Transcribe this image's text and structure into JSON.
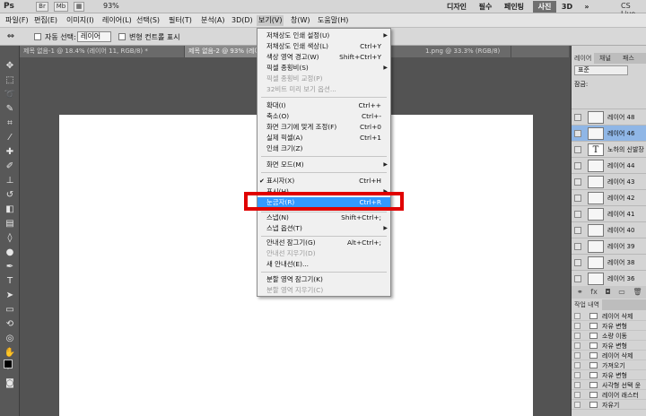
{
  "app": {
    "logo": "Ps",
    "zoom": "93%",
    "workspaces": [
      "디자인",
      "필수",
      "페인팅",
      "사진",
      "3D"
    ],
    "active_workspace": "사진",
    "cs_live": "CS Live"
  },
  "menubar": [
    "파일(F)",
    "편집(E)",
    "이미지(I)",
    "레이어(L)",
    "선택(S)",
    "필터(T)",
    "분석(A)",
    "3D(D)",
    "보기(V)",
    "창(W)",
    "도움말(H)"
  ],
  "options": {
    "auto_select_label": "자동 선택:",
    "auto_select_value": "레이어",
    "transform_controls_label": "변형 컨트롤 표시"
  },
  "tabs": [
    "제목 없음-1 @ 18.4% (레이어 11, RGB/8) *",
    "제목 없음-2 @ 93% (레이어 46, RGB/8) *",
    "1.png @ 33.3% (RGB/8)"
  ],
  "view_menu": [
    {
      "label": "저채상도 인쇄 설정(U)",
      "shortcut": "",
      "submenu": true
    },
    {
      "label": "저채상도 인쇄 색상(L)",
      "shortcut": "Ctrl+Y"
    },
    {
      "label": "색상 영역 경고(W)",
      "shortcut": "Shift+Ctrl+Y"
    },
    {
      "label": "픽셀 종횡비(S)",
      "shortcut": "",
      "submenu": true
    },
    {
      "label": "픽셀 종횡비 교정(P)",
      "shortcut": "",
      "disabled": true
    },
    {
      "label": "32비트 미리 보기 옵션...",
      "shortcut": "",
      "disabled": true
    },
    {
      "label": "확대(I)",
      "shortcut": "Ctrl++"
    },
    {
      "label": "축소(O)",
      "shortcut": "Ctrl+-"
    },
    {
      "label": "화면 크기에 맞게 조정(F)",
      "shortcut": "Ctrl+0"
    },
    {
      "label": "실제 픽셀(A)",
      "shortcut": "Ctrl+1"
    },
    {
      "label": "인쇄 크기(Z)",
      "shortcut": ""
    },
    {
      "label": "화면 모드(M)",
      "shortcut": "",
      "submenu": true
    },
    {
      "label": "표시자(X)",
      "shortcut": "Ctrl+H",
      "checked": true
    },
    {
      "label": "표시(H)",
      "shortcut": "",
      "submenu": true
    },
    {
      "label": "눈금자(R)",
      "shortcut": "Ctrl+R",
      "highlighted": true
    },
    {
      "label": "스냅(N)",
      "shortcut": "Shift+Ctrl+;"
    },
    {
      "label": "스냅 옵션(T)",
      "shortcut": "",
      "submenu": true
    },
    {
      "label": "안내선 잠그기(G)",
      "shortcut": "Alt+Ctrl+;"
    },
    {
      "label": "안내선 지우기(D)",
      "shortcut": "",
      "disabled": true
    },
    {
      "label": "새 안내선(E)...",
      "shortcut": ""
    },
    {
      "label": "분할 영역 잠그기(K)",
      "shortcut": ""
    },
    {
      "label": "분할 영역 지우기(C)",
      "shortcut": "",
      "disabled": true
    }
  ],
  "panel": {
    "tabs": [
      "레이어",
      "채널",
      "패스"
    ],
    "blend_mode": "표준",
    "lock_label": "잠금:",
    "layers": [
      {
        "name": "레이어 48"
      },
      {
        "name": "레이어 46",
        "selected": true
      },
      {
        "name": "노하의 신발장",
        "type": "T"
      },
      {
        "name": "레이어 44"
      },
      {
        "name": "레이어 43"
      },
      {
        "name": "레이어 42"
      },
      {
        "name": "레이어 41"
      },
      {
        "name": "레이어 40"
      },
      {
        "name": "레이어 39"
      },
      {
        "name": "레이어 38"
      },
      {
        "name": "레이어 36"
      }
    ],
    "history_title": "작업 내역",
    "history": [
      "레이어 삭제",
      "자유 변형",
      "소량 이동",
      "자유 변형",
      "레이어 삭제",
      "가져오기",
      "자유 변형",
      "사각형 선택 윤",
      "레이어 래스터",
      "자유기"
    ]
  }
}
